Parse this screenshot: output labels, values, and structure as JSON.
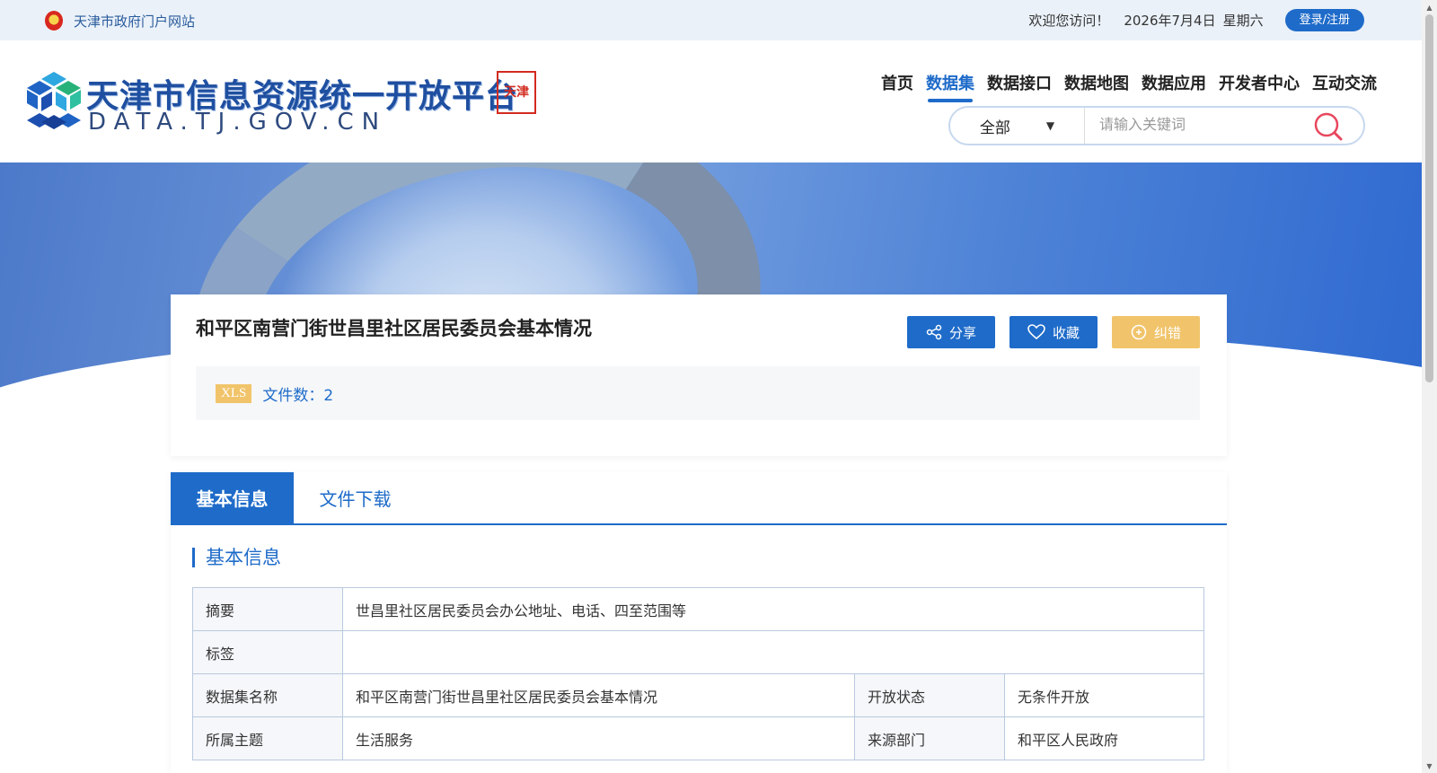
{
  "topbar": {
    "gov_portal": "天津市政府门户网站",
    "welcome": "欢迎您访问！",
    "date": "2026年7月4日",
    "weekday": "星期六",
    "login": "登录/注册"
  },
  "header": {
    "logo_title": "天津市信息资源统一开放平台",
    "logo_domain": "DATA.TJ.GOV.CN",
    "seal_text": "天津"
  },
  "nav": {
    "items": [
      {
        "label": "首页",
        "active": false
      },
      {
        "label": "数据集",
        "active": true
      },
      {
        "label": "数据接口",
        "active": false
      },
      {
        "label": "数据地图",
        "active": false
      },
      {
        "label": "数据应用",
        "active": false
      },
      {
        "label": "开发者中心",
        "active": false
      },
      {
        "label": "互动交流",
        "active": false
      }
    ]
  },
  "search": {
    "scope": "全部",
    "placeholder": "请输入关键词"
  },
  "dataset": {
    "title": "和平区南营门街世昌里社区居民委员会基本情况",
    "share": "分享",
    "favorite": "收藏",
    "report": "纠错",
    "format_badge": "XLS",
    "file_count_label": "文件数：2"
  },
  "tabs": {
    "basic_info": "基本信息",
    "download": "文件下载"
  },
  "section": {
    "title": "基本信息"
  },
  "info_table": {
    "summary_label": "摘要",
    "summary_value": "世昌里社区居民委员会办公地址、电话、四至范围等",
    "tags_label": "标签",
    "tags_value": "",
    "name_label": "数据集名称",
    "name_value": "和平区南营门街世昌里社区居民委员会基本情况",
    "status_label": "开放状态",
    "status_value": "无条件开放",
    "topic_label": "所属主题",
    "topic_value": "生活服务",
    "dept_label": "来源部门",
    "dept_value": "和平区人民政府"
  },
  "colors": {
    "accent": "#1e6bc9",
    "warning": "#f1c46b",
    "topbar_bg": "#eaf1f9"
  }
}
